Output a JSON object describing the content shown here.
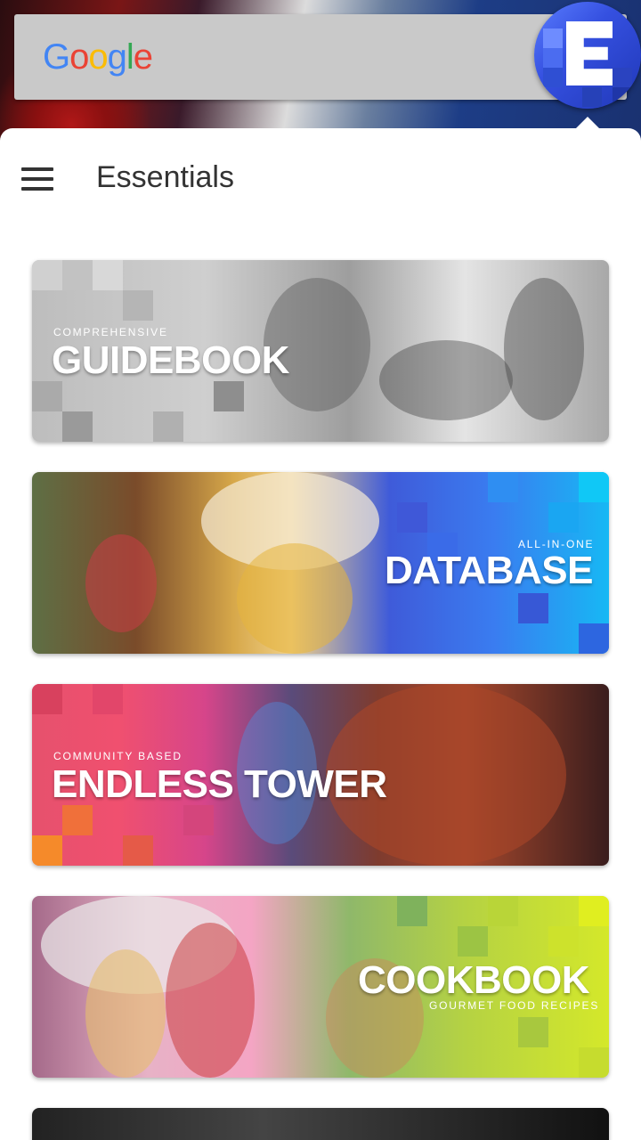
{
  "search_widget": {
    "logo_letters": [
      {
        "char": "G",
        "color": "#4285F4"
      },
      {
        "char": "o",
        "color": "#EA4335"
      },
      {
        "char": "o",
        "color": "#FBBC05"
      },
      {
        "char": "g",
        "color": "#4285F4"
      },
      {
        "char": "l",
        "color": "#34A853"
      },
      {
        "char": "e",
        "color": "#EA4335"
      }
    ]
  },
  "app_icon": {
    "icon": "essentials-e-icon",
    "color": "#3550e0"
  },
  "panel": {
    "title": "Essentials",
    "menu_icon": "hamburger-menu-icon"
  },
  "cards": [
    {
      "subtitle": "COMPREHENSIVE",
      "title": "GUIDEBOOK",
      "theme": "grayscale"
    },
    {
      "subtitle": "ALL-IN-ONE",
      "title": "DATABASE",
      "theme": "blue"
    },
    {
      "subtitle": "COMMUNITY BASED",
      "title": "ENDLESS TOWER",
      "theme": "red-pink"
    },
    {
      "subtitle": "GOURMET FOOD RECIPES",
      "title": "COOKBOOK",
      "theme": "lime"
    }
  ]
}
